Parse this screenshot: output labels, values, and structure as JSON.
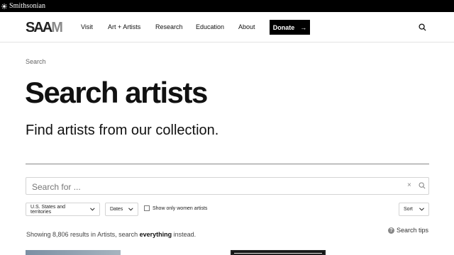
{
  "topbar": {
    "brand": "Smithsonian"
  },
  "nav": {
    "logo_left": "SAA",
    "logo_right": "M",
    "items": [
      {
        "label": "Visit"
      },
      {
        "label": "Art + Artists"
      },
      {
        "label": "Research"
      },
      {
        "label": "Education"
      },
      {
        "label": "About"
      }
    ],
    "donate_label": "Donate",
    "donate_arrow": "→"
  },
  "breadcrumb": "Search",
  "page": {
    "title": "Search artists",
    "subtitle": "Find artists from our collection."
  },
  "search": {
    "placeholder": "Search for ...",
    "value": "",
    "clear_glyph": "×"
  },
  "filters": {
    "region": "U.S. States and territories",
    "dates": "Dates",
    "women_only_label": "Show only women artists",
    "women_only_checked": false,
    "sort": "Sort"
  },
  "results": {
    "prefix": "Showing 8,806 results in Artists, search ",
    "link": "everything",
    "suffix": " instead."
  },
  "tips": {
    "icon_glyph": "?",
    "label": "Search tips"
  },
  "colors": {
    "topbar": "#000000",
    "donate_bg": "#000000",
    "text": "#111111",
    "muted": "#666666"
  }
}
